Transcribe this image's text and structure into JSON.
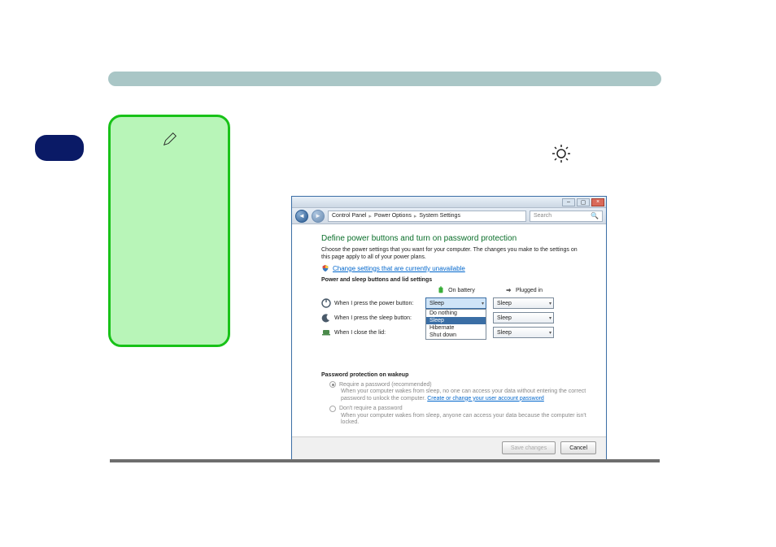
{
  "breadcrumb": {
    "item1": "Control Panel",
    "item2": "Power Options",
    "item3": "System Settings"
  },
  "search": {
    "placeholder": "Search"
  },
  "heading": "Define power buttons and turn on password protection",
  "sub": "Choose the power settings that you want for your computer. The changes you make to the settings on this page apply to all of your power plans.",
  "change_link": "Change settings that are currently unavailable",
  "section_power": "Power and sleep buttons and lid settings",
  "cols": {
    "battery": "On battery",
    "plugged": "Plugged in"
  },
  "rows": {
    "power": "When I press the power button:",
    "sleepbtn": "When I press the sleep button:",
    "lid": "When I close the lid:"
  },
  "dropdowns": {
    "power_battery": "Sleep",
    "power_plugged": "Sleep",
    "sleep_battery": "Sleep",
    "sleep_plugged": "Sleep",
    "lid_battery": "Sleep",
    "lid_plugged": "Sleep"
  },
  "options": {
    "o0": "Do nothing",
    "o1": "Sleep",
    "o2": "Hibernate",
    "o3": "Shut down"
  },
  "pw_section": "Password protection on wakeup",
  "pw_opt1": "Require a password (recommended)",
  "pw_desc1a": "When your computer wakes from sleep, no one can access your data without entering the correct password to unlock the computer. ",
  "pw_desc1_link": "Create or change your user account password",
  "pw_opt2": "Don't require a password",
  "pw_desc2": "When your computer wakes from sleep, anyone can access your data because the computer isn't locked.",
  "buttons": {
    "save": "Save changes",
    "cancel": "Cancel"
  }
}
